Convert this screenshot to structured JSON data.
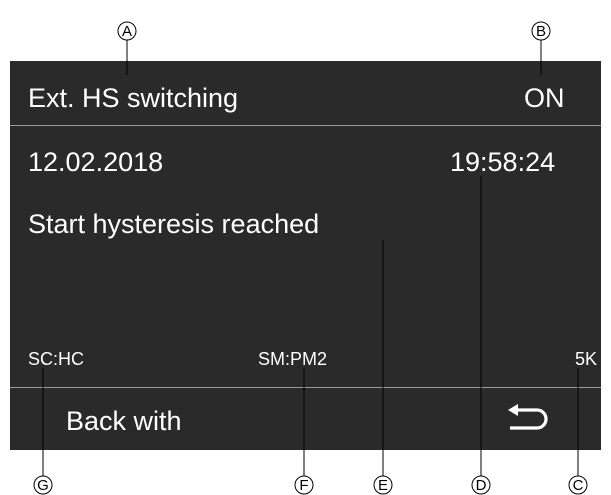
{
  "screen": {
    "title": "Ext. HS switching",
    "state": "ON",
    "date": "12.02.2018",
    "time": "19:58:24",
    "message": "Start hysteresis reached",
    "status": {
      "left": "SC:HC",
      "middle": "SM:PM2",
      "right": "5K"
    },
    "back_label": "Back with",
    "back_icon": "return-arrow-icon"
  },
  "callouts": [
    "A",
    "B",
    "C",
    "D",
    "E",
    "F",
    "G"
  ],
  "colors": {
    "screen_bg": "#2a2a2a",
    "text": "#ffffff",
    "divider": "#9a9a9a"
  }
}
